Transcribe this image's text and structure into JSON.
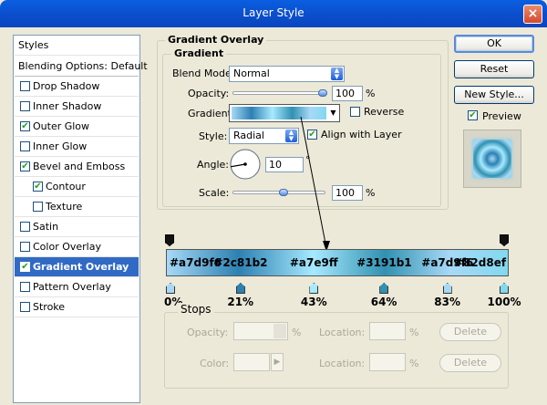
{
  "window": {
    "title": "Layer Style",
    "close_glyph": "×"
  },
  "left_panel": {
    "items": [
      {
        "label": "Styles",
        "checkbox": false,
        "checked": false,
        "indent": false,
        "selected": false
      },
      {
        "label": "Blending Options: Default",
        "checkbox": false,
        "checked": false,
        "indent": false,
        "selected": false
      },
      {
        "label": "Drop Shadow",
        "checkbox": true,
        "checked": false,
        "indent": false,
        "selected": false
      },
      {
        "label": "Inner Shadow",
        "checkbox": true,
        "checked": false,
        "indent": false,
        "selected": false
      },
      {
        "label": "Outer Glow",
        "checkbox": true,
        "checked": true,
        "indent": false,
        "selected": false
      },
      {
        "label": "Inner Glow",
        "checkbox": true,
        "checked": false,
        "indent": false,
        "selected": false
      },
      {
        "label": "Bevel and Emboss",
        "checkbox": true,
        "checked": true,
        "indent": false,
        "selected": false
      },
      {
        "label": "Contour",
        "checkbox": true,
        "checked": true,
        "indent": true,
        "selected": false
      },
      {
        "label": "Texture",
        "checkbox": true,
        "checked": false,
        "indent": true,
        "selected": false
      },
      {
        "label": "Satin",
        "checkbox": true,
        "checked": false,
        "indent": false,
        "selected": false
      },
      {
        "label": "Color Overlay",
        "checkbox": true,
        "checked": false,
        "indent": false,
        "selected": false
      },
      {
        "label": "Gradient Overlay",
        "checkbox": true,
        "checked": true,
        "indent": false,
        "selected": true
      },
      {
        "label": "Pattern Overlay",
        "checkbox": true,
        "checked": false,
        "indent": false,
        "selected": false
      },
      {
        "label": "Stroke",
        "checkbox": true,
        "checked": false,
        "indent": false,
        "selected": false
      }
    ]
  },
  "gradient_overlay": {
    "section_title": "Gradient Overlay",
    "group_title": "Gradient",
    "blend_mode": {
      "label": "Blend Mode:",
      "value": "Normal"
    },
    "opacity": {
      "label": "Opacity:",
      "value": "100",
      "unit": "%",
      "level": 1.0
    },
    "gradient": {
      "label": "Gradient:"
    },
    "reverse": {
      "label": "Reverse",
      "checked": false
    },
    "style": {
      "label": "Style:",
      "value": "Radial"
    },
    "align_with_layer": {
      "label": "Align with Layer",
      "checked": true
    },
    "angle": {
      "label": "Angle:",
      "value": "10",
      "unit": "°",
      "degrees": 10
    },
    "scale": {
      "label": "Scale:",
      "value": "100",
      "unit": "%",
      "level": 0.55
    }
  },
  "buttons": {
    "ok": "OK",
    "reset": "Reset",
    "new_style": "New Style...",
    "preview": "Preview",
    "preview_checked": true
  },
  "gradient_editor": {
    "stops": [
      {
        "hex": "#a7d9f6",
        "pct": "0%",
        "pos": 0
      },
      {
        "hex": "#2c81b2",
        "pct": "21%",
        "pos": 21
      },
      {
        "hex": "#a7e9ff",
        "pct": "43%",
        "pos": 43
      },
      {
        "hex": "#3191b1",
        "pct": "64%",
        "pos": 64
      },
      {
        "hex": "#a7d9f6",
        "pct": "83%",
        "pos": 83
      },
      {
        "hex": "#82d8ef",
        "pct": "100%",
        "pos": 100
      }
    ]
  },
  "stops_panel": {
    "title": "Stops",
    "opacity_label": "Opacity:",
    "color_label": "Color:",
    "location_label": "Location:",
    "pct_unit": "%",
    "delete_label": "Delete"
  },
  "colors": {
    "accent": "#316ac5",
    "title_blue": "#0b4fce"
  }
}
